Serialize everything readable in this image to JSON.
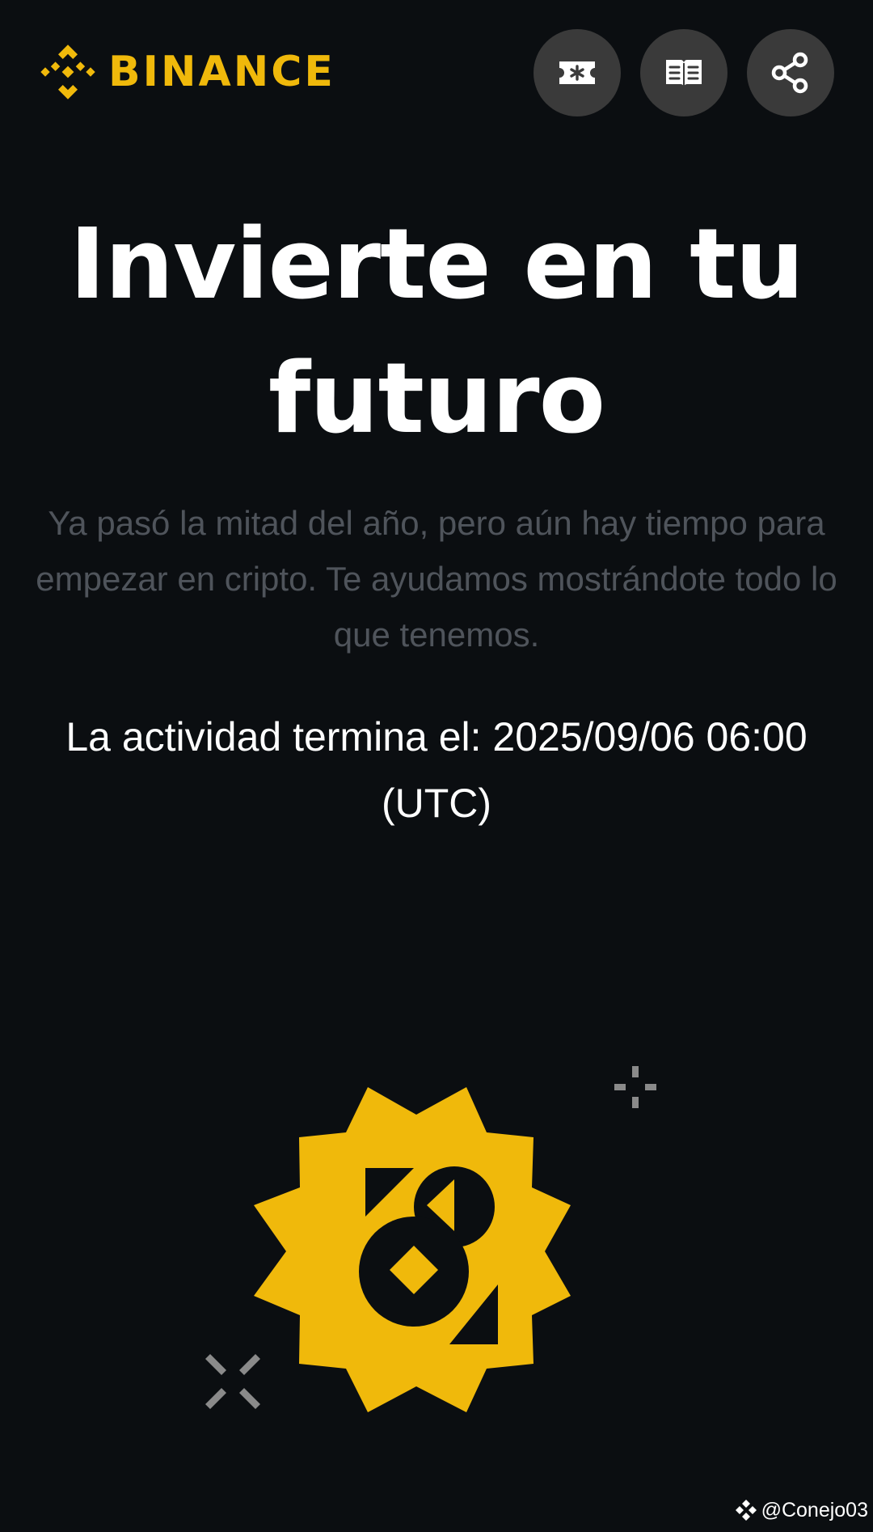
{
  "header": {
    "brand": "BINANCE",
    "icons": [
      "ticket-icon",
      "book-icon",
      "share-icon"
    ]
  },
  "hero": {
    "title": "Invierte en tu futuro",
    "subtitle": "Ya pasó la mitad del año, pero aún hay tiempo para empezar en cripto. Te ayudamos mostrándote todo lo que tenemos.",
    "end_date": "La actividad termina el: 2025/09/06 06:00 (UTC)"
  },
  "watermark": {
    "handle": "@Conejo03"
  },
  "colors": {
    "background": "#0b0e11",
    "brand_yellow": "#f0b90b",
    "button_bg": "#3a3a3a",
    "subtitle": "#4f545b",
    "text": "#ffffff"
  }
}
